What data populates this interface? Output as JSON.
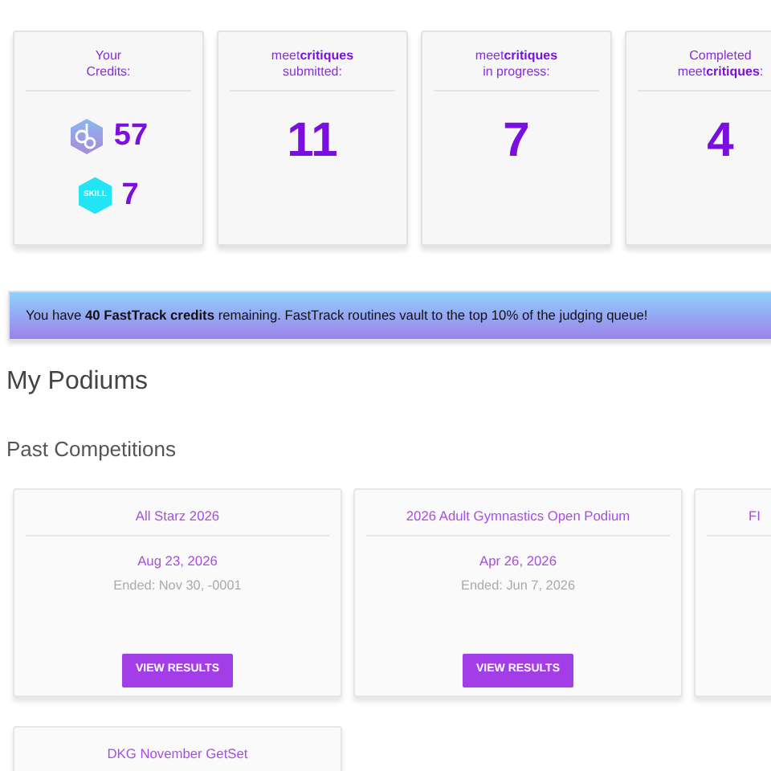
{
  "stats": [
    {
      "kind": "credits",
      "header_lines": [
        "Your",
        "Credits:"
      ],
      "credits": [
        {
          "kind": "credit",
          "amount": "57"
        },
        {
          "kind": "skill",
          "badge_label": "SKILL",
          "amount": "7"
        }
      ]
    },
    {
      "kind": "count",
      "header_lines": [
        "meet**critiques**",
        "submitted:"
      ],
      "value": "11"
    },
    {
      "kind": "count",
      "header_lines": [
        "meet**critiques**",
        "in progress:"
      ],
      "value": "7"
    },
    {
      "kind": "count",
      "header_lines": [
        "Completed",
        "meet**critiques**:"
      ],
      "value": "4"
    }
  ],
  "alert": "You have **40 FastTrack credits** remaining. FastTrack routines vault to the top 10% of the judging queue!",
  "page_title": "My Podiums",
  "section_title": "Past Competitions",
  "competitions": [
    {
      "kind": "full",
      "title": "All Starz 2026",
      "date": "Aug 23, 2026",
      "ended": "Ended: Nov 30, -0001",
      "button": "VIEW RESULTS"
    },
    {
      "kind": "full",
      "title": "2026 Adult Gymnastics Open Podium",
      "date": "Apr 26, 2026",
      "ended": "Ended: Jun 7, 2026",
      "button": "VIEW RESULTS"
    },
    {
      "kind": "cut",
      "title": "FI"
    },
    {
      "kind": "top",
      "title": "DKG November GetSet"
    }
  ]
}
